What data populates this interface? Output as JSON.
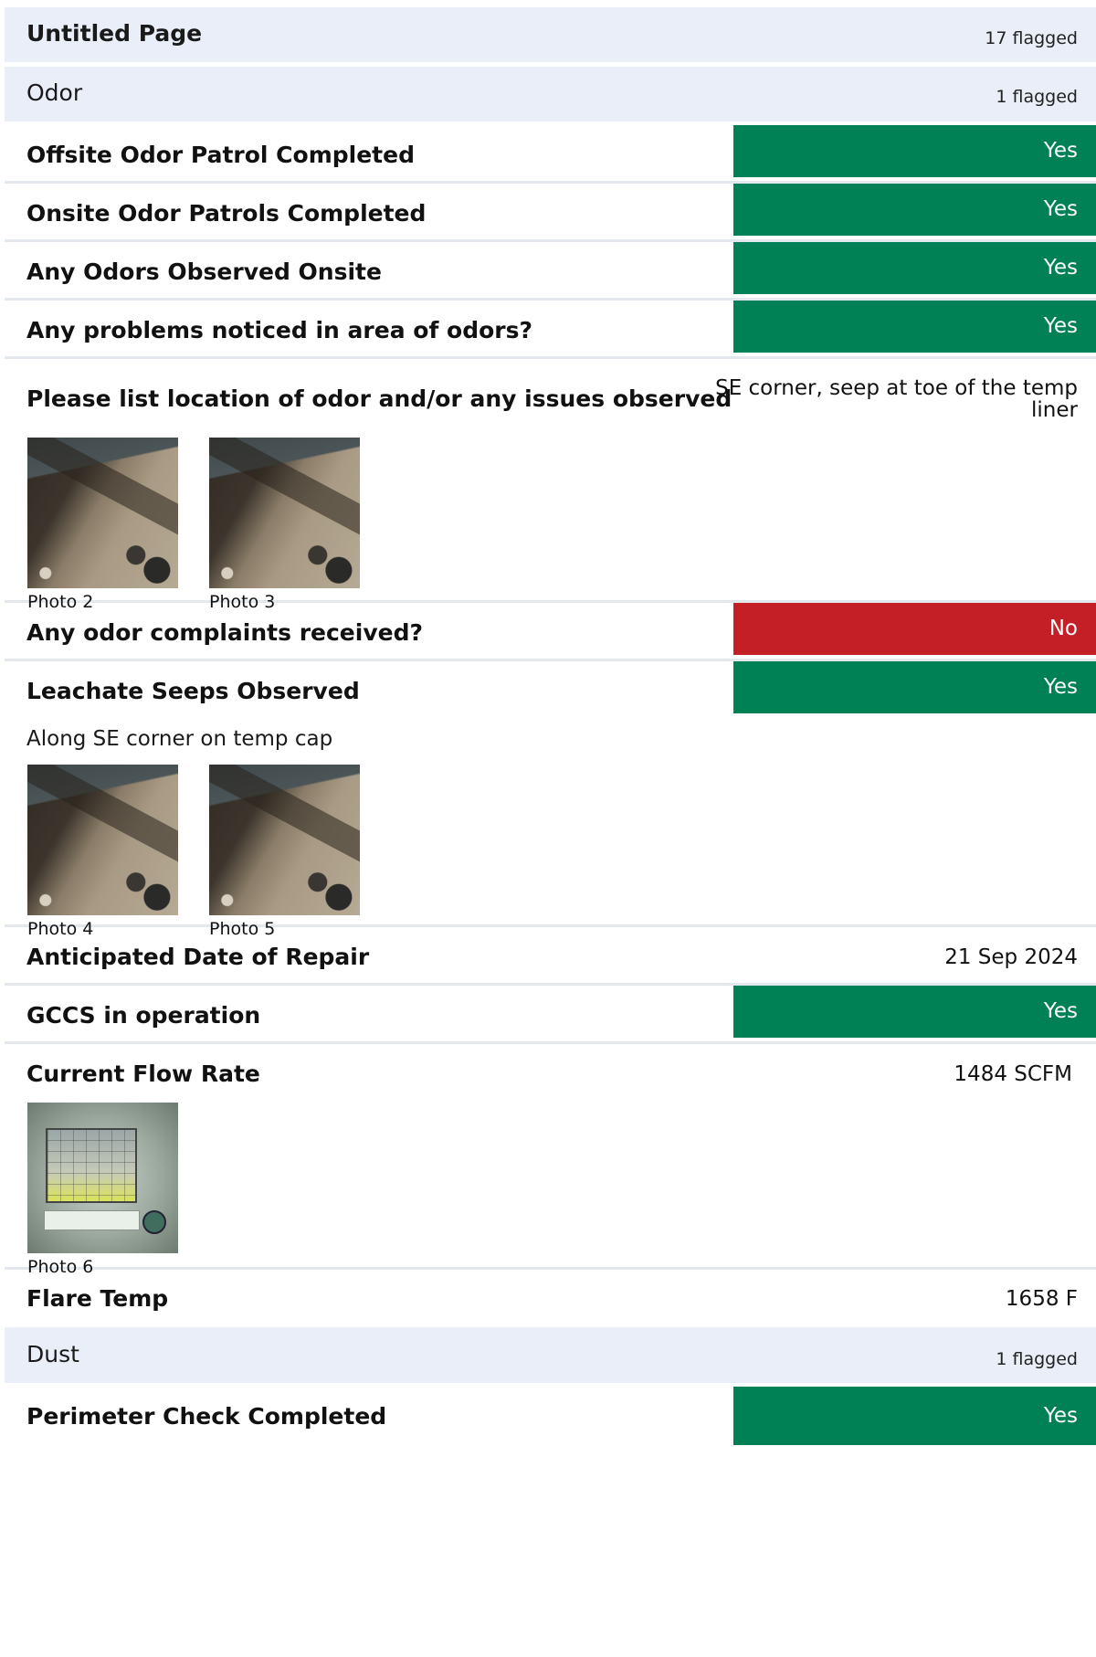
{
  "page_section": {
    "title": "Untitled Page",
    "flagged": "17 flagged"
  },
  "odor_section": {
    "title": "Odor",
    "flagged": "1 flagged"
  },
  "rows": {
    "offsite": {
      "question": "Offsite Odor Patrol Completed",
      "answer": "Yes"
    },
    "onsite": {
      "question": "Onsite Odor Patrols Completed",
      "answer": "Yes"
    },
    "odors_observed": {
      "question": "Any Odors Observed Onsite",
      "answer": "Yes"
    },
    "problems": {
      "question": "Any problems noticed in area of odors?",
      "answer": "Yes"
    },
    "location": {
      "question": "Please list location of odor and/or any issues observed",
      "answer_line1": "SE corner, seep at toe of the temp",
      "answer_line2": "liner",
      "photos": [
        "Photo 2",
        "Photo 3"
      ]
    },
    "complaints": {
      "question": "Any odor complaints received?",
      "answer": "No"
    },
    "leachate": {
      "question": "Leachate Seeps Observed",
      "answer": "Yes",
      "note": "Along SE corner on temp cap",
      "photos": [
        "Photo 4",
        "Photo 5"
      ]
    },
    "repair_date": {
      "question": "Anticipated Date of Repair",
      "value": "21 Sep 2024"
    },
    "gccs": {
      "question": "GCCS in operation",
      "answer": "Yes"
    },
    "flow_rate": {
      "question": "Current Flow Rate",
      "value": "1484 SCFM",
      "photos": [
        "Photo 6"
      ]
    },
    "flare_temp": {
      "question": "Flare Temp",
      "value": "1658 F"
    }
  },
  "dust_section": {
    "title": "Dust",
    "flagged": "1 flagged"
  },
  "perimeter": {
    "question": "Perimeter Check Completed",
    "answer": "Yes"
  },
  "colors": {
    "yes": "#008055",
    "no": "#c41e26",
    "section_bg": "#e9eef8",
    "divider": "#e3e7ee"
  }
}
